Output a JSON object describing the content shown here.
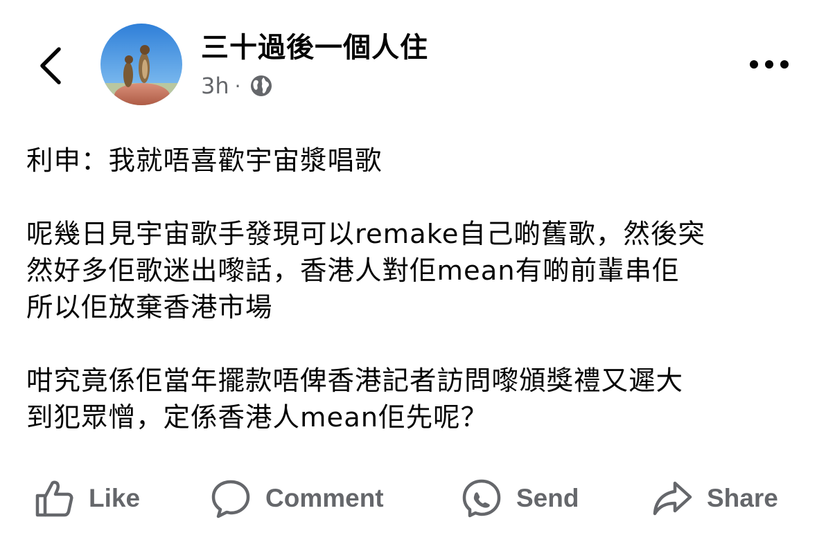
{
  "header": {
    "back_icon": "chevron-left-icon",
    "page_name": "三十過後一個人住",
    "time": "3h",
    "separator": "·",
    "audience_icon": "globe-icon",
    "more_icon": "more-horizontal-icon"
  },
  "post": {
    "paragraphs": [
      {
        "lines": [
          "利申：我就唔喜歡宇宙漿唱歌"
        ]
      },
      {
        "lines": [
          "呢幾日見宇宙歌手發現可以remake自己啲舊歌，然後突",
          "然好多佢歌迷出嚟話，香港人對佢mean有啲前輩串佢",
          "所以佢放棄香港市場"
        ]
      },
      {
        "lines": [
          "咁究竟係佢當年擺款唔俾香港記者訪問嚟頒獎禮又遲大",
          "到犯眾憎，定係香港人mean佢先呢？"
        ]
      }
    ]
  },
  "actions": {
    "like": {
      "label": "Like",
      "icon": "thumbs-up-icon"
    },
    "comment": {
      "label": "Comment",
      "icon": "comment-bubble-icon"
    },
    "send": {
      "label": "Send",
      "icon": "messenger-icon"
    },
    "share": {
      "label": "Share",
      "icon": "share-arrow-icon"
    }
  },
  "colors": {
    "text": "#050505",
    "secondary": "#65676b",
    "background": "#ffffff"
  }
}
